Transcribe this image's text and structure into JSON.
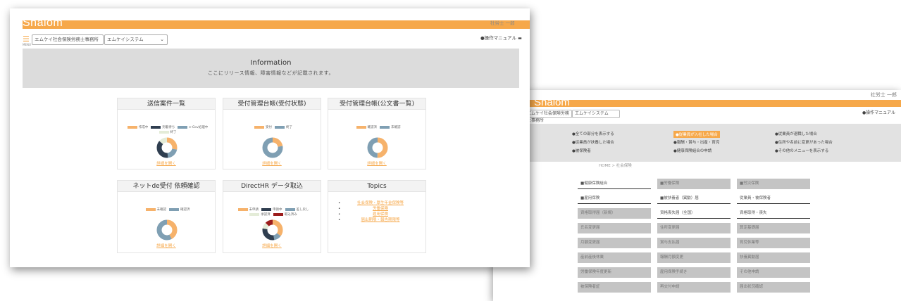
{
  "back": {
    "logo": "Shalom",
    "user": "社労士 一郎",
    "selects": [
      "エムケイ社会保険労務士事務所",
      "エムケイシステム"
    ],
    "manual": "●操作マニュアル",
    "links": [
      [
        "●全ての部分を表示する",
        "●従業員が入社した場合",
        "●従業員が退職した場合"
      ],
      [
        "●従業員が扶養した場合",
        "●報酬・賞与・出産・育児",
        "●住所や名前に変更があった場合"
      ],
      [
        "●被保険者",
        "●健康保険組合の申請",
        "●その他のメニューを表示する"
      ]
    ],
    "breadcrumb": "HOME > 社会保険",
    "cells": [
      [
        "■健康保険組合",
        "■労働保険",
        "■労災保険"
      ],
      [
        "■雇用保険",
        "■被扶養者（異動）届",
        "従業員・被保険者"
      ],
      [
        "資格取得届（新規）",
        "資格喪失届（全国）",
        "資格取得・喪失"
      ],
      [
        "氏名変更届",
        "住所変更届",
        "算定基礎届"
      ],
      [
        "月額変更届",
        "賞与支払届",
        "育児休業等"
      ],
      [
        "産前産後休業",
        "報酬月額変更",
        "扶養異動届"
      ],
      [
        "労働保険年度更新",
        "雇用保険手続き",
        "その他申請"
      ],
      [
        "被保険者証",
        "再交付申請",
        "届出状況確認"
      ]
    ]
  },
  "front": {
    "logo": "Shalom",
    "user": "社労士 一郎",
    "menu_label": "MENU",
    "office_select": "エムケイ社会保険労務士事務所",
    "system_select": "エムケイシステム",
    "manual": "●操作マニュアル",
    "info": {
      "title": "Information",
      "subtitle": "ここにリリース情報、障害情報などが記載されます。"
    },
    "cards": [
      {
        "title": "送信案件一覧",
        "legend": [
          [
            "#f6b26b",
            "作成中"
          ],
          [
            "#2f3e50",
            "到着待ち"
          ],
          [
            "#7f9fb3",
            "e-Gov処理中"
          ],
          [
            "#e4ecd8",
            "終了"
          ]
        ],
        "segments": [
          [
            "#f6b26b",
            0.28
          ],
          [
            "#7f9fb3",
            0.2
          ],
          [
            "#2f3e50",
            0.38
          ],
          [
            "#e4ecd8",
            0.14
          ]
        ],
        "link": "詳細を開く"
      },
      {
        "title": "受付管理台帳(受付状態)",
        "legend": [
          [
            "#f6b26b",
            "受付"
          ],
          [
            "#7f9fb3",
            "終了"
          ]
        ],
        "segments": [
          [
            "#f6b26b",
            0.22
          ],
          [
            "#7f9fb3",
            0.78
          ]
        ],
        "link": "詳細を開く"
      },
      {
        "title": "受付管理台帳(公文書一覧)",
        "legend": [
          [
            "#f6b26b",
            "確認済"
          ],
          [
            "#7f9fb3",
            "未確認"
          ]
        ],
        "segments": [
          [
            "#f6b26b",
            0.5
          ],
          [
            "#7f9fb3",
            0.5
          ]
        ],
        "link": "詳細を開く"
      },
      {
        "title": "ネットde受付 依頼確認",
        "legend": [
          [
            "#f6b26b",
            "未確認"
          ],
          [
            "#7f9fb3",
            "確認済"
          ]
        ],
        "segments": [
          [
            "#f6b26b",
            0.42
          ],
          [
            "#7f9fb3",
            0.58
          ]
        ],
        "link": "詳細を開く"
      },
      {
        "title": "DirectHR データ取込",
        "legend": [
          [
            "#f6b26b",
            "未申請"
          ],
          [
            "#2f3e50",
            "申請中"
          ],
          [
            "#7f9fb3",
            "差し戻し"
          ],
          [
            "#e4ecd8",
            "承認済"
          ],
          [
            "#9b1c1c",
            "取込済み"
          ]
        ],
        "segments": [
          [
            "#f6b26b",
            0.35
          ],
          [
            "#7f9fb3",
            0.12
          ],
          [
            "#2f3e50",
            0.3
          ],
          [
            "#e4ecd8",
            0.1
          ],
          [
            "#9b1c1c",
            0.13
          ]
        ],
        "link": "詳細を開く"
      }
    ],
    "topics": {
      "title": "Topics",
      "items": [
        "社会保険・厚生年金保険等",
        "労働保険",
        "雇用保険",
        "届出期限・報告期限等"
      ]
    }
  }
}
